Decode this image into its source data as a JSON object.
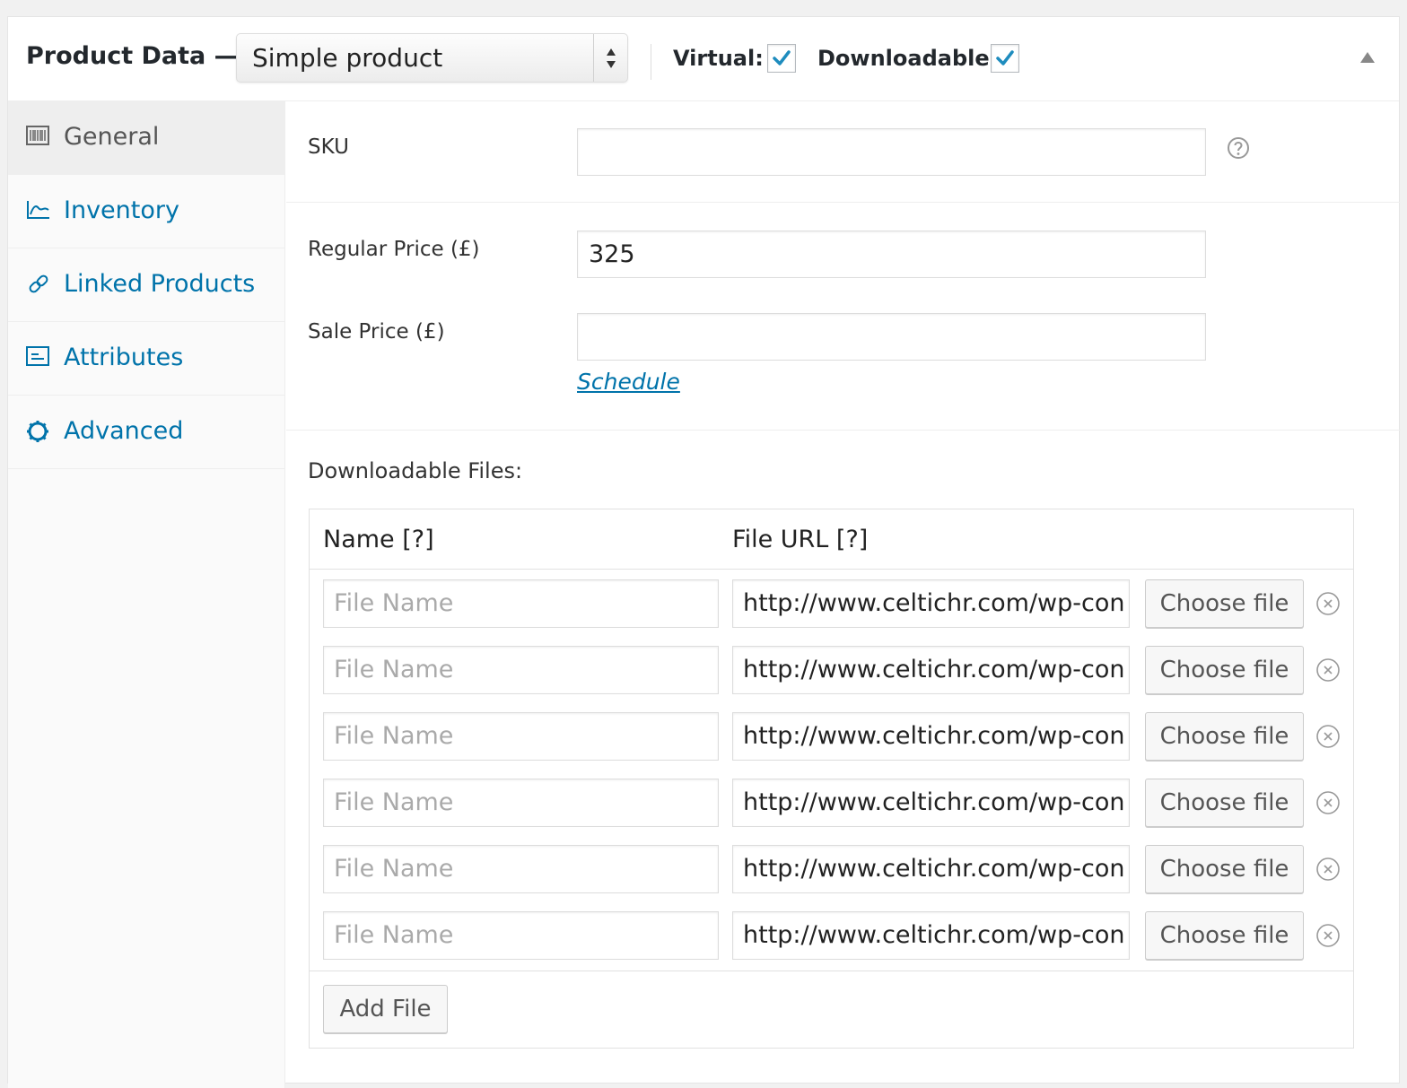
{
  "header": {
    "title": "Product Data —",
    "product_type": "Simple product",
    "virtual_label": "Virtual:",
    "virtual_checked": true,
    "downloadable_label": "Downloadable:",
    "downloadable_checked": true
  },
  "sidebar": {
    "items": [
      {
        "label": "General",
        "icon": "barcode-icon",
        "active": true
      },
      {
        "label": "Inventory",
        "icon": "chart-icon",
        "active": false
      },
      {
        "label": "Linked Products",
        "icon": "link-icon",
        "active": false
      },
      {
        "label": "Attributes",
        "icon": "list-icon",
        "active": false
      },
      {
        "label": "Advanced",
        "icon": "gear-icon",
        "active": false
      }
    ]
  },
  "general": {
    "sku_label": "SKU",
    "sku_value": "",
    "regular_price_label": "Regular Price (£)",
    "regular_price_value": "325",
    "sale_price_label": "Sale Price (£)",
    "sale_price_value": "",
    "schedule_link": "Schedule",
    "downloadable_files_label": "Downloadable Files:",
    "files_table": {
      "name_header": "Name [?]",
      "url_header": "File URL [?]",
      "rows": [
        {
          "name_placeholder": "File Name",
          "url": "http://www.celtichr.com/wp-con",
          "button": "Choose file"
        },
        {
          "name_placeholder": "File Name",
          "url": "http://www.celtichr.com/wp-con",
          "button": "Choose file"
        },
        {
          "name_placeholder": "File Name",
          "url": "http://www.celtichr.com/wp-con",
          "button": "Choose file"
        },
        {
          "name_placeholder": "File Name",
          "url": "http://www.celtichr.com/wp-con",
          "button": "Choose file"
        },
        {
          "name_placeholder": "File Name",
          "url": "http://www.celtichr.com/wp-con",
          "button": "Choose file"
        },
        {
          "name_placeholder": "File Name",
          "url": "http://www.celtichr.com/wp-con",
          "button": "Choose file"
        }
      ],
      "add_file_button": "Add File"
    }
  },
  "colors": {
    "accent": "#0073aa",
    "check": "#1e8cbe"
  }
}
